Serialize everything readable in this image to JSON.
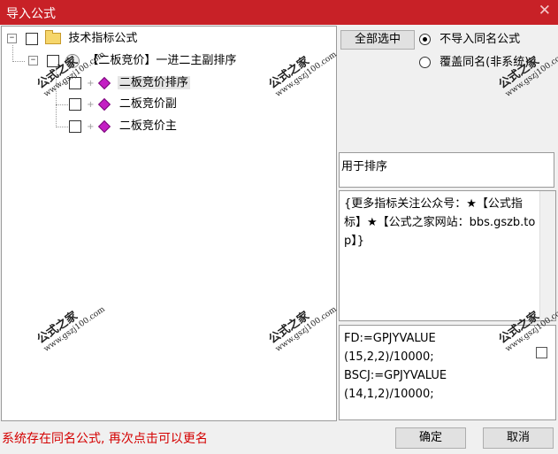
{
  "window": {
    "title": "导入公式",
    "close_glyph": "✕"
  },
  "tree": {
    "root": {
      "label": "技术指标公式"
    },
    "group": {
      "label": "【二板竞价】一进二主副排序"
    },
    "items": [
      {
        "label": "二板竞价排序",
        "selected": true
      },
      {
        "label": "二板竞价副",
        "selected": false
      },
      {
        "label": "二板竞价主",
        "selected": false
      }
    ]
  },
  "options": {
    "select_all_label": "全部选中",
    "radio_skip_label": "不导入同名公式",
    "radio_overwrite_label": "覆盖同名(非系统)",
    "selected_radio": "skip"
  },
  "info": {
    "usage": "用于排序",
    "description": "{更多指标关注公众号：★【公式指标】★【公式之家网站：bbs.gszb.top】}",
    "code": "FD:=GPJYVALUE\n(15,2,2)/10000;\nBSCJ:=GPJYVALUE\n(14,1,2)/10000;"
  },
  "status": {
    "message": "系统存在同名公式, 再次点击可以更名"
  },
  "buttons": {
    "ok": "确定",
    "cancel": "取消"
  },
  "watermark": {
    "title": "公式之家",
    "url": "www.gszj100.com"
  },
  "colors": {
    "title_bar": "#c82127",
    "status_text": "#d40000",
    "accent_gem": "#c41ec4",
    "folder": "#f6d66b"
  }
}
